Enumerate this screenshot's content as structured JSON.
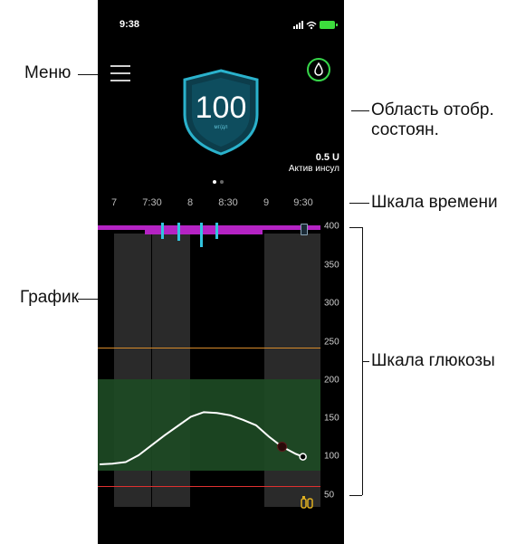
{
  "status_bar": {
    "time": "9:38"
  },
  "glucose": {
    "value": "100",
    "unit": "мг/дл"
  },
  "insulin": {
    "amount": "0.5 U",
    "label": "Актив инсул"
  },
  "time_axis": {
    "ticks": [
      "7",
      "7:30",
      "8",
      "8:30",
      "9",
      "9:30"
    ]
  },
  "glucose_axis": {
    "ticks": [
      "400",
      "350",
      "300",
      "250",
      "200",
      "150",
      "100",
      "50"
    ]
  },
  "annotations": {
    "menu": "Меню",
    "status_area": "Область отобр.\nсостоян.",
    "time_scale": "Шкала времени",
    "graph": "График",
    "glucose_scale": "Шкала глюкозы"
  },
  "colors": {
    "shield": "#1f8fa8",
    "target_range": "#1d4a24",
    "insulin_bar": "#b423c4",
    "bolus": "#32c4de",
    "low_line": "#e03030",
    "high_line": "#d68a2a"
  },
  "chart_data": {
    "type": "line",
    "x": [
      "7:00",
      "7:10",
      "7:20",
      "7:30",
      "7:40",
      "7:50",
      "8:00",
      "8:10",
      "8:20",
      "8:30",
      "8:40",
      "8:50",
      "9:00",
      "9:10",
      "9:20",
      "9:30",
      "9:36"
    ],
    "y": [
      90,
      91,
      93,
      102,
      115,
      128,
      140,
      152,
      158,
      157,
      154,
      148,
      141,
      126,
      113,
      104,
      100
    ],
    "ylim": [
      40,
      400
    ],
    "target_range": [
      70,
      180
    ],
    "high_limit": 245,
    "low_limit": 65
  }
}
